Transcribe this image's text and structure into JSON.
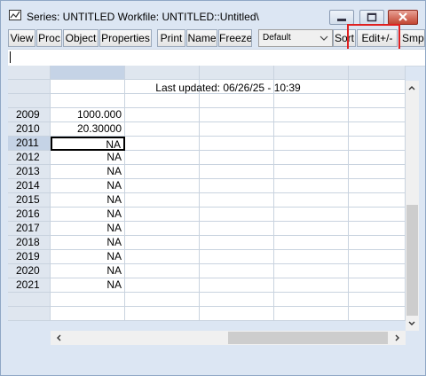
{
  "window": {
    "title": "Series: UNTITLED   Workfile: UNTITLED::Untitled\\",
    "icon": "chart-window-icon",
    "controls": [
      "minimize-icon",
      "maximize-icon",
      "close-icon"
    ]
  },
  "toolbar": {
    "buttons": [
      "View",
      "Proc",
      "Object",
      "Properties",
      "Print",
      "Name",
      "Freeze",
      "Sort",
      "Edit+/-",
      "Smpl"
    ],
    "display_select": "Default",
    "highlighted_button": "Edit+/-",
    "highlight_color": "#e02020"
  },
  "edit_field": {
    "value": ""
  },
  "sheet": {
    "last_updated": "Last updated: 06/26/25 - 10:39",
    "rows": [
      {
        "year": "2009",
        "value": "1000.000"
      },
      {
        "year": "2010",
        "value": "20.30000"
      },
      {
        "year": "2011",
        "value": "NA"
      },
      {
        "year": "2012",
        "value": "NA"
      },
      {
        "year": "2013",
        "value": "NA"
      },
      {
        "year": "2014",
        "value": "NA"
      },
      {
        "year": "2015",
        "value": "NA"
      },
      {
        "year": "2016",
        "value": "NA"
      },
      {
        "year": "2017",
        "value": "NA"
      },
      {
        "year": "2018",
        "value": "NA"
      },
      {
        "year": "2019",
        "value": "NA"
      },
      {
        "year": "2020",
        "value": "NA"
      },
      {
        "year": "2021",
        "value": "NA"
      }
    ],
    "selected_year": "2011"
  }
}
